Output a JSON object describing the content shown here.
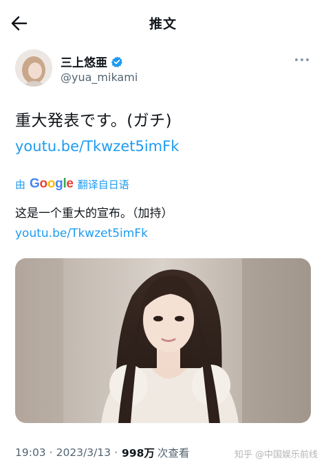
{
  "header": {
    "title": "推文",
    "back_icon": "arrow-left-icon"
  },
  "author": {
    "name": "三上悠亜",
    "handle": "@yua_mikami",
    "verified": true,
    "verified_color": "#1d9bf0"
  },
  "tweet": {
    "text": "重大発表です。(ガチ)",
    "link": "youtu.be/Tkwzet5imFk"
  },
  "translation": {
    "by": "由",
    "google": "Google",
    "action": "翻译自日语",
    "text": "这是一个重大的宣布。（加持）",
    "link": "youtu.be/Tkwzet5imFk"
  },
  "meta": {
    "time": "19:03",
    "dot1": "·",
    "date": "2023/3/13",
    "dot2": "·",
    "views": "998万",
    "views_label": "次查看"
  },
  "watermark": "知乎 @中国娱乐前线",
  "colors": {
    "link": "#1d9bf0",
    "text": "#0f1419",
    "secondary": "#536471"
  }
}
